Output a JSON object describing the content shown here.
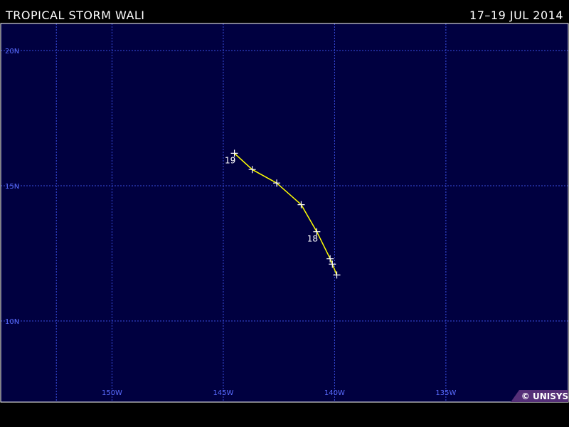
{
  "header": {
    "title": "TROPICAL STORM WALI",
    "dates": "17–19  JUL  2014"
  },
  "map": {
    "lon_range": [
      155,
      129.5
    ],
    "lat_range": [
      7,
      21
    ],
    "colors": {
      "ocean": "#000040",
      "grid": "#3a4ee0",
      "grid_label": "#5a6cff",
      "track": "#ffff00",
      "marker": "#ffffff",
      "border": "#ffffff",
      "copyright_bg": "#552f78"
    },
    "lat_labels": [
      {
        "lat": 20,
        "text": "20N"
      },
      {
        "lat": 15,
        "text": "15N"
      },
      {
        "lat": 10,
        "text": "10N"
      }
    ],
    "lon_labels": [
      {
        "lon": 150,
        "text": "150W"
      },
      {
        "lon": 145,
        "text": "145W"
      },
      {
        "lon": 140,
        "text": "140W"
      },
      {
        "lon": 135,
        "text": "135W"
      }
    ],
    "grid_lats": [
      20,
      15,
      10
    ],
    "grid_lons": [
      152.5,
      150,
      145,
      140,
      135
    ],
    "copyright": "© UNISYS"
  },
  "track": {
    "name": "WALI",
    "points": [
      {
        "lat": 11.7,
        "lon": 139.9
      },
      {
        "lat": 12.1,
        "lon": 140.1
      },
      {
        "lat": 12.3,
        "lon": 140.2
      },
      {
        "lat": 13.3,
        "lon": 140.8
      },
      {
        "lat": 14.3,
        "lon": 141.5
      },
      {
        "lat": 15.1,
        "lon": 142.6
      },
      {
        "lat": 15.6,
        "lon": 143.7
      },
      {
        "lat": 16.2,
        "lon": 144.5
      }
    ],
    "day_labels": [
      {
        "text": "18",
        "point_index": 3
      },
      {
        "text": "19",
        "point_index": 7
      }
    ]
  }
}
